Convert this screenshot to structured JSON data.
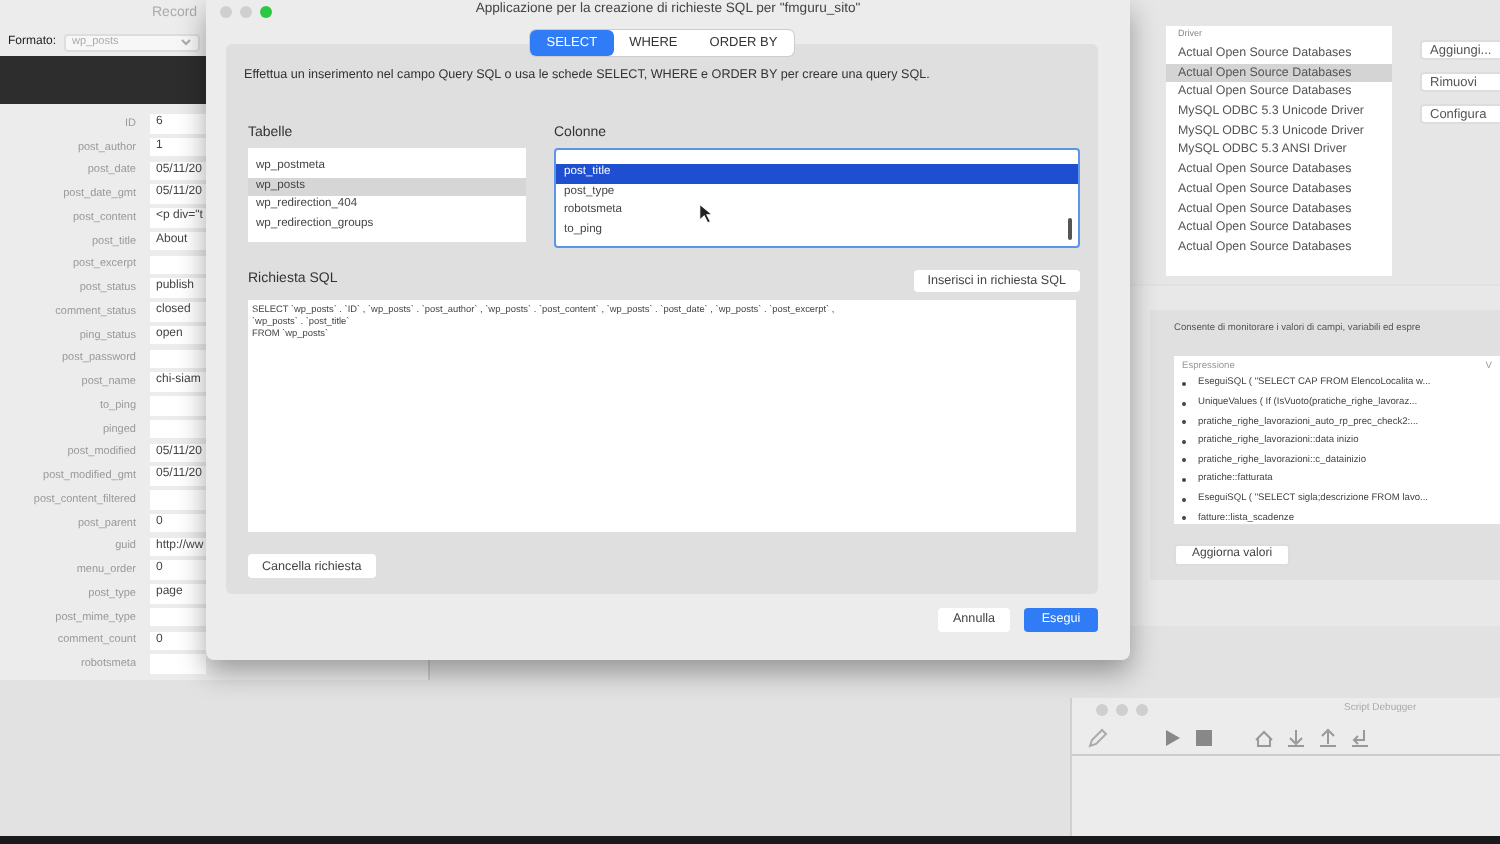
{
  "record_window": {
    "title": "Record",
    "format_label": "Formato:",
    "format_value": "wp_posts",
    "fields": [
      {
        "label": "ID",
        "value": "6"
      },
      {
        "label": "post_author",
        "value": "1"
      },
      {
        "label": "post_date",
        "value": "05/11/20"
      },
      {
        "label": "post_date_gmt",
        "value": "05/11/20"
      },
      {
        "label": "post_content",
        "value": "<p div=\"t"
      },
      {
        "label": "post_title",
        "value": "About"
      },
      {
        "label": "post_excerpt"
      },
      {
        "label": "post_status",
        "value": "publish"
      },
      {
        "label": "comment_status",
        "value": "closed"
      },
      {
        "label": "ping_status",
        "value": "open"
      },
      {
        "label": "post_password"
      },
      {
        "label": "post_name",
        "value": "chi-siam"
      },
      {
        "label": "to_ping"
      },
      {
        "label": "pinged"
      },
      {
        "label": "post_modified",
        "value": "05/11/20"
      },
      {
        "label": "post_modified_gmt",
        "value": "05/11/20"
      },
      {
        "label": "post_content_filtered"
      },
      {
        "label": "post_parent",
        "value": "0"
      },
      {
        "label": "guid",
        "value": "http://ww"
      },
      {
        "label": "menu_order",
        "value": "0"
      },
      {
        "label": "post_type",
        "value": "page"
      },
      {
        "label": "post_mime_type"
      },
      {
        "label": "comment_count",
        "value": "0"
      },
      {
        "label": "robotsmeta"
      }
    ]
  },
  "odbc_window": {
    "column_header": "Driver",
    "drivers": [
      {
        "name": "Actual Open Source Databases",
        "selected": false
      },
      {
        "name": "Actual Open Source Databases",
        "selected": true
      },
      {
        "name": "Actual Open Source Databases",
        "selected": false
      },
      {
        "name": "MySQL ODBC 5.3 Unicode Driver",
        "selected": false
      },
      {
        "name": "MySQL ODBC 5.3 Unicode Driver",
        "selected": false
      },
      {
        "name": "MySQL ODBC 5.3 ANSI Driver",
        "selected": false
      },
      {
        "name": "Actual Open Source Databases",
        "selected": false
      },
      {
        "name": "Actual Open Source Databases",
        "selected": false
      },
      {
        "name": "Actual Open Source Databases",
        "selected": false
      },
      {
        "name": "Actual Open Source Databases",
        "selected": false
      },
      {
        "name": "Actual Open Source Databases",
        "selected": false
      }
    ],
    "buttons": [
      "Aggiungi...",
      "Rimuovi",
      "Configura"
    ]
  },
  "data_viewer": {
    "description": "Consente di monitorare i valori di campi, variabili ed espre",
    "columns": [
      "Espressione",
      "V"
    ],
    "rows": [
      "EseguiSQL ( \"SELECT CAP FROM ElencoLocalita w...",
      "UniqueValues ( If (IsVuoto(pratiche_righe_lavoraz...",
      "pratiche_righe_lavorazioni_auto_rp_prec_check2:...",
      "pratiche_righe_lavorazioni::data inizio",
      "pratiche_righe_lavorazioni::c_datainizio",
      "pratiche::fatturata",
      "EseguiSQL ( \"SELECT sigla;descrizione FROM lavo...",
      "fatture::lista_scadenze"
    ],
    "refresh_button": "Aggiorna valori"
  },
  "script_debugger": {
    "title": "Script Debugger"
  },
  "sql_dialog": {
    "title": "Applicazione per la creazione di richieste SQL per \"fmguru_sito\"",
    "tabs": [
      {
        "label": "SELECT",
        "selected": true
      },
      {
        "label": "WHERE",
        "selected": false
      },
      {
        "label": "ORDER BY",
        "selected": false
      }
    ],
    "description": "Effettua un inserimento nel campo Query SQL o usa le schede SELECT, WHERE e ORDER BY per creare una query SQL.",
    "tables": {
      "label": "Tabelle",
      "items": [
        {
          "name": "wp_postmeta",
          "selected": false
        },
        {
          "name": "wp_posts",
          "selected": true
        },
        {
          "name": "wp_redirection_404",
          "selected": false
        },
        {
          "name": "wp_redirection_groups",
          "selected": false
        }
      ]
    },
    "columns": {
      "label": "Colonne",
      "items": [
        {
          "name": "post_title",
          "selected": true
        },
        {
          "name": "post_type",
          "selected": false
        },
        {
          "name": "robotsmeta",
          "selected": false
        },
        {
          "name": "to_ping",
          "selected": false
        }
      ]
    },
    "sql_label": "Richiesta SQL",
    "insert_button": "Inserisci in richiesta SQL",
    "sql_text": "SELECT `wp_posts` . `ID` , `wp_posts` . `post_author` , `wp_posts` . `post_content` , `wp_posts` . `post_date` , `wp_posts` . `post_excerpt` ,\n`wp_posts` . `post_title`\nFROM `wp_posts`",
    "clear_button": "Cancella richiesta",
    "buttons": [
      {
        "label": "Annulla",
        "kind": "secondary"
      },
      {
        "label": "Esegui",
        "kind": "primary"
      }
    ]
  }
}
